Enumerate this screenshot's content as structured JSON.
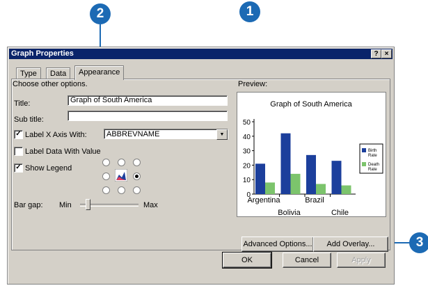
{
  "callouts": {
    "one": "1",
    "two": "2",
    "three": "3"
  },
  "window": {
    "title": "Graph Properties",
    "help_label": "?",
    "close_label": "×"
  },
  "tabs": [
    {
      "label": "Type"
    },
    {
      "label": "Data"
    },
    {
      "label": "Appearance"
    }
  ],
  "appearance": {
    "instructions": "Choose other options.",
    "title_label": "Title:",
    "title_value": "Graph of South America",
    "subtitle_label": "Sub title:",
    "subtitle_value": "",
    "label_x_axis_label": "Label X Axis With:",
    "label_x_axis_checked": true,
    "label_x_axis_value": "ABBREVNAME",
    "label_data_label": "Label Data With Value",
    "label_data_checked": false,
    "show_legend_label": "Show Legend",
    "show_legend_checked": true,
    "legend_position_selected": "right",
    "bar_gap_label": "Bar gap:",
    "bar_gap_min": "Min",
    "bar_gap_max": "Max",
    "bar_gap_value": 0.1,
    "preview_label": "Preview:",
    "advanced_button": "Advanced Options...",
    "overlay_button": "Add Overlay..."
  },
  "footer": {
    "ok": "OK",
    "cancel": "Cancel",
    "apply": "Apply"
  },
  "colors": {
    "title_bar": "#0a246a",
    "callout": "#1c6ab4",
    "birth_bar": "#1c3f9c",
    "death_bar": "#7cc46c"
  },
  "chart_data": {
    "type": "bar",
    "title": "Graph of South America",
    "categories": [
      "Argentina",
      "Bolivia",
      "Brazil",
      "Chile"
    ],
    "series": [
      {
        "name": "Birth Rate",
        "values": [
          21,
          42,
          27,
          23
        ]
      },
      {
        "name": "Death Rate",
        "values": [
          8,
          14,
          7,
          6
        ]
      }
    ],
    "yticks": [
      "0",
      "10",
      "20",
      "30",
      "40",
      "50"
    ],
    "ylim": [
      0,
      50
    ],
    "legend": "right"
  }
}
